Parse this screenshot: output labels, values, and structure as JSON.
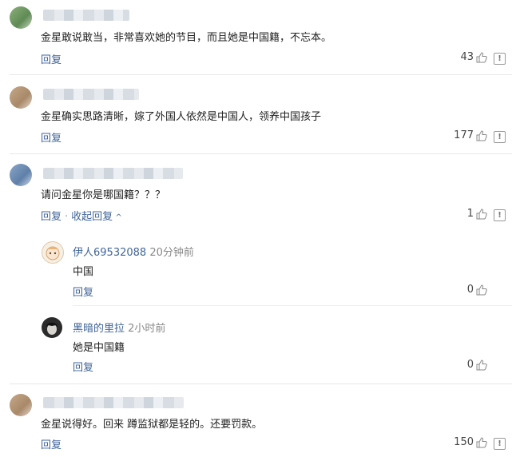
{
  "comments": [
    {
      "text": "金星敢说敢当，非常喜欢她的节目，而且她是中国籍，不忘本。",
      "reply_label": "回复",
      "likes": "43"
    },
    {
      "text": "金星确实思路清晰，嫁了外国人依然是中国人，领养中国孩子",
      "reply_label": "回复",
      "likes": "177"
    },
    {
      "text": "请问金星你是哪国籍？？？",
      "reply_label": "回复",
      "collapse_label": "收起回复",
      "likes": "1",
      "sub_replies": [
        {
          "user": "伊人69532088",
          "time": "20分钟前",
          "text": "中国",
          "reply_label": "回复",
          "likes": "0"
        },
        {
          "user": "黑暗的里拉",
          "time": "2小时前",
          "text": "她是中国籍",
          "reply_label": "回复",
          "likes": "0"
        }
      ]
    },
    {
      "text": "金星说得好。回来 蹲监狱都是轻的。还要罚款。",
      "reply_label": "回复",
      "likes": "150"
    }
  ],
  "icons": {
    "like": "thumbs-up-icon",
    "report": "report-icon"
  },
  "colors": {
    "link": "#406599",
    "divider": "#e8e8e8"
  }
}
